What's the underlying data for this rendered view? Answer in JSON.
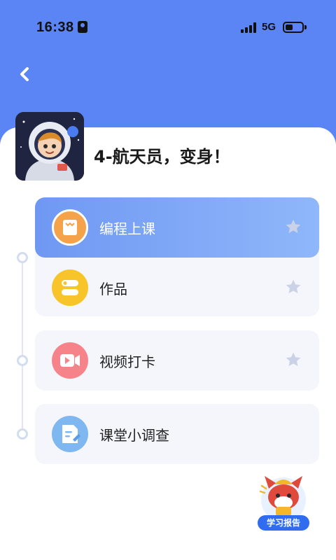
{
  "status_bar": {
    "time": "16:38",
    "network": "5G"
  },
  "header": {
    "back_icon": "chevron-left-icon"
  },
  "lesson": {
    "title": "4-航天员，变身！",
    "thumbnail": "astronaut-illustration"
  },
  "menu": {
    "items": [
      {
        "label": "编程上课",
        "icon": "book-icon",
        "icon_color": "#f5a34a",
        "starred": false,
        "active": true
      },
      {
        "label": "作品",
        "icon": "toggle-icon",
        "icon_color": "#f7c52a",
        "starred": false,
        "active": false
      },
      {
        "label": "视频打卡",
        "icon": "video-icon",
        "icon_color": "#f7838a",
        "starred": false,
        "active": false
      },
      {
        "label": "课堂小调查",
        "icon": "survey-icon",
        "icon_color": "#7fb7f0",
        "starred": null,
        "active": false
      }
    ]
  },
  "report": {
    "label": "学习报告",
    "icon": "fox-mascot-icon"
  },
  "colors": {
    "header_blue": "#5b85f5",
    "active_gradient_start": "#6f98f3",
    "active_gradient_end": "#8fb7fa",
    "card_bg": "#f5f6fb",
    "star_inactive": "#c9d2e6"
  }
}
